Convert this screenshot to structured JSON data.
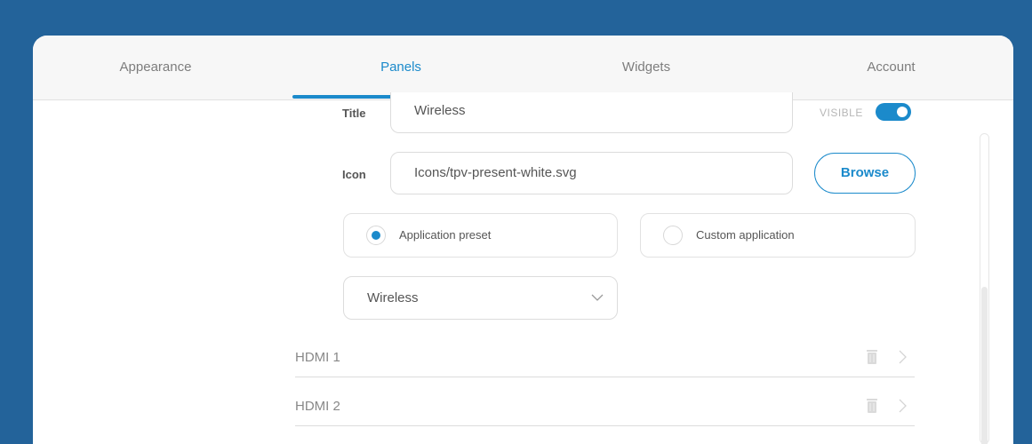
{
  "tabs": [
    {
      "label": "Appearance",
      "active": false
    },
    {
      "label": "Panels",
      "active": true
    },
    {
      "label": "Widgets",
      "active": false
    },
    {
      "label": "Account",
      "active": false
    }
  ],
  "panel": {
    "title_label": "Title",
    "title_value": "Wireless",
    "visible_label": "VISIBLE",
    "visible_on": true,
    "icon_label": "Icon",
    "icon_value": "Icons/tpv-present-white.svg",
    "browse_label": "Browse",
    "options": [
      {
        "label": "Application preset",
        "selected": true
      },
      {
        "label": "Custom application",
        "selected": false
      }
    ],
    "preset_value": "Wireless"
  },
  "list": [
    {
      "name": "HDMI 1"
    },
    {
      "name": "HDMI 2"
    }
  ],
  "colors": {
    "background": "#23639a",
    "accent": "#1b8acb",
    "tabbar": "#f7f7f7"
  },
  "icons": [
    "chevron-down-icon",
    "trash-icon",
    "chevron-right-icon"
  ]
}
